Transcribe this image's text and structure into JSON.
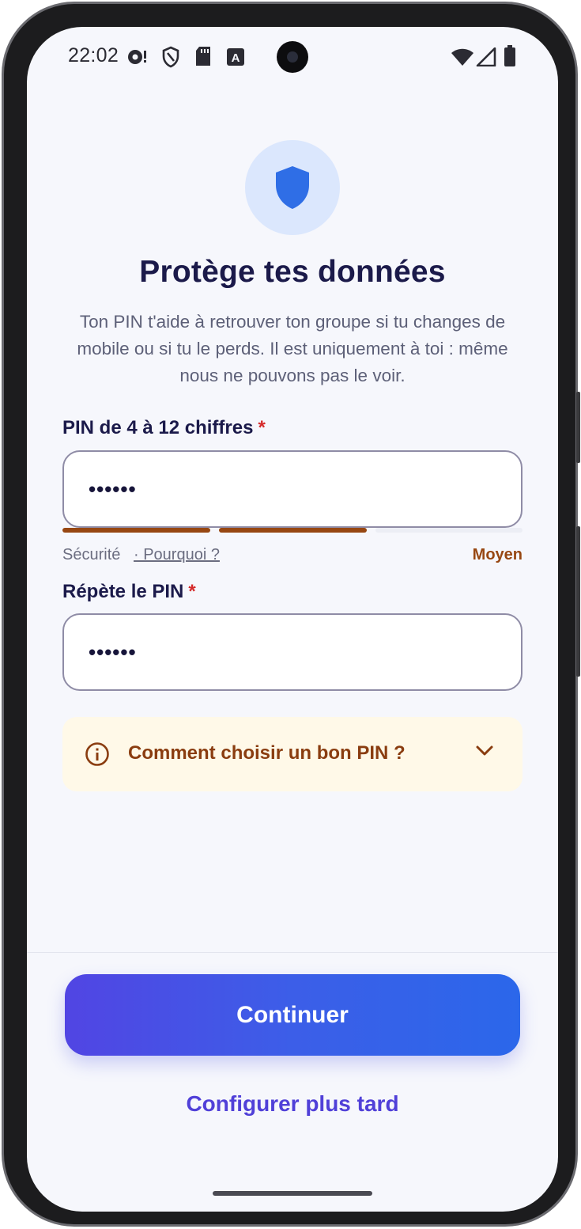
{
  "status_bar": {
    "time": "22:02",
    "icons": [
      "sync-alert-icon",
      "shield-status-icon",
      "sd-card-icon",
      "accessibility-a-icon",
      "wifi-icon",
      "cellular-signal-icon",
      "battery-icon"
    ]
  },
  "hero": {
    "icon": "shield-icon",
    "title": "Protège tes données",
    "subtitle": "Ton PIN t'aide à retrouver ton groupe si tu changes de mobile ou si tu le perds. Il est uniquement à toi : même nous ne pouvons pas le voir."
  },
  "pin": {
    "label": "PIN de 4 à 12 chiffres",
    "required_mark": "*",
    "value": "••••••",
    "strength": {
      "label": "Sécurité",
      "link": "· Pourquoi ?",
      "level_text": "Moyen",
      "segments_filled": 2,
      "segments_total": 3,
      "color": "#974712"
    }
  },
  "confirm_pin": {
    "label": "Répète le PIN",
    "required_mark": "*",
    "value": "••••••"
  },
  "tips": {
    "icon": "info-icon",
    "text": "Comment choisir un bon PIN ?",
    "expand_icon": "chevron-down-icon"
  },
  "actions": {
    "continue_label": "Continuer",
    "later_label": "Configurer plus tard"
  },
  "colors": {
    "accent": "#4f46e5",
    "accent_end": "#2b67ea",
    "title": "#1b1a4a",
    "warning_bg": "#fff9e8",
    "warning_text": "#8a3d10",
    "required": "#d52a2a"
  }
}
